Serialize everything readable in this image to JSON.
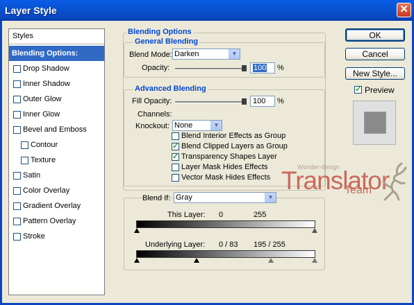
{
  "window": {
    "title": "Layer Style",
    "close_glyph": "✕"
  },
  "sidebar": {
    "header": "Styles",
    "active_item": "Blending Options: Custom",
    "items": [
      {
        "label": "Drop Shadow",
        "checked": false,
        "indent": false
      },
      {
        "label": "Inner Shadow",
        "checked": false,
        "indent": false
      },
      {
        "label": "Outer Glow",
        "checked": false,
        "indent": false
      },
      {
        "label": "Inner Glow",
        "checked": false,
        "indent": false
      },
      {
        "label": "Bevel and Emboss",
        "checked": false,
        "indent": false
      },
      {
        "label": "Contour",
        "checked": false,
        "indent": true
      },
      {
        "label": "Texture",
        "checked": false,
        "indent": true
      },
      {
        "label": "Satin",
        "checked": false,
        "indent": false
      },
      {
        "label": "Color Overlay",
        "checked": false,
        "indent": false
      },
      {
        "label": "Gradient Overlay",
        "checked": false,
        "indent": false
      },
      {
        "label": "Pattern Overlay",
        "checked": false,
        "indent": false
      },
      {
        "label": "Stroke",
        "checked": false,
        "indent": false
      }
    ]
  },
  "blending": {
    "section_title": "Blending Options",
    "general_title": "General Blending",
    "blend_mode_label": "Blend Mode:",
    "blend_mode_value": "Darken",
    "opacity_label": "Opacity:",
    "opacity_value": "100",
    "opacity_unit": "%",
    "opacity_fraction": 1.0
  },
  "advanced": {
    "title": "Advanced Blending",
    "fill_opacity_label": "Fill Opacity:",
    "fill_opacity_value": "100",
    "fill_unit": "%",
    "fill_fraction": 1.0,
    "channels_label": "Channels:",
    "knockout_label": "Knockout:",
    "knockout_value": "None",
    "options": [
      {
        "label": "Blend Interior Effects as Group",
        "checked": false
      },
      {
        "label": "Blend Clipped Layers as Group",
        "checked": true
      },
      {
        "label": "Transparency Shapes Layer",
        "checked": true
      },
      {
        "label": "Layer Mask Hides Effects",
        "checked": false
      },
      {
        "label": "Vector Mask Hides Effects",
        "checked": false
      }
    ]
  },
  "blend_if": {
    "label": "Blend If:",
    "value": "Gray",
    "this_layer_label": "This Layer:",
    "this_layer_low": "0",
    "this_layer_high": "255",
    "underlying_label": "Underlying Layer:",
    "underlying_low": "0 / 83",
    "underlying_high": "195 / 255"
  },
  "buttons": {
    "ok": "OK",
    "cancel": "Cancel",
    "new_style": "New Style...",
    "preview_label": "Preview",
    "preview_checked": true
  },
  "watermark": {
    "top": "Wonder-design",
    "main": "Translator",
    "sub": "Team"
  },
  "colors": {
    "title_blue": "#0a5ce6",
    "accent": "#316ac5",
    "legend_blue": "#0046d5",
    "watermark": "#c96a5e"
  }
}
